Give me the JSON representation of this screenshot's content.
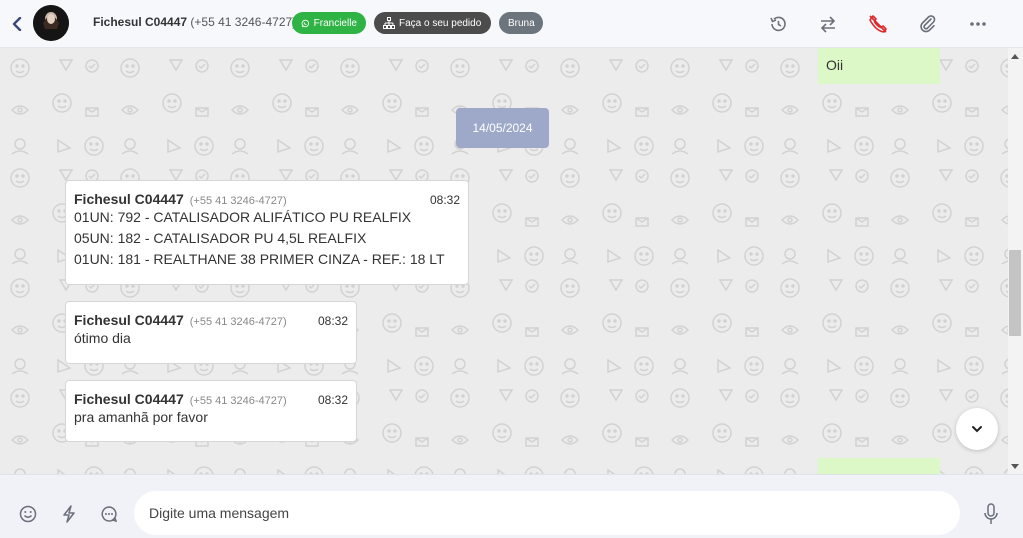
{
  "header": {
    "contact_name": "Fichesul C04447",
    "contact_phone": "(+55 41 3246-4727)",
    "avatar_label": "Cidadão",
    "tags": {
      "whatsapp": "Francielle",
      "order": "Faça o seu pedido",
      "agent": "Bruna"
    }
  },
  "chat": {
    "top_outgoing": "Oii",
    "date_separator": "14/05/2024",
    "messages": [
      {
        "name": "Fichesul C04447",
        "phone": "(+55 41 3246-4727)",
        "time": "08:32",
        "lines": [
          "01UN: 792 - CATALISADOR ALIFÁTICO PU REALFIX",
          "05UN: 182 - CATALISADOR PU 4,5L REALFIX",
          "01UN: 181 - REALTHANE 38 PRIMER CINZA - REF.: 18 LT"
        ]
      },
      {
        "name": "Fichesul C04447",
        "phone": "(+55 41 3246-4727)",
        "time": "08:32",
        "lines": [
          "ótimo dia"
        ]
      },
      {
        "name": "Fichesul C04447",
        "phone": "(+55 41 3246-4727)",
        "time": "08:32",
        "lines": [
          "pra amanhã por favor"
        ]
      }
    ]
  },
  "composer": {
    "placeholder": "Digite uma mensagem"
  },
  "colors": {
    "whatsapp_tag": "#2fb344",
    "order_tag": "#4c4c4c",
    "agent_tag": "#6c757d",
    "outgoing_bubble": "#dcf8c6",
    "date_chip": "#9ea9c9",
    "end_call": "#e0282b"
  }
}
